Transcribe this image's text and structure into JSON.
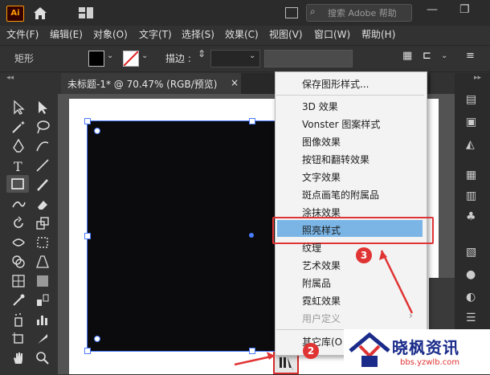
{
  "app": {
    "logo": "Ai"
  },
  "title_bar": {
    "search_placeholder": "搜索 Adobe 帮助"
  },
  "menu": [
    {
      "label": "文件(F)"
    },
    {
      "label": "编辑(E)"
    },
    {
      "label": "对象(O)"
    },
    {
      "label": "文字(T)"
    },
    {
      "label": "选择(S)"
    },
    {
      "label": "效果(C)"
    },
    {
      "label": "视图(V)"
    },
    {
      "label": "窗口(W)"
    },
    {
      "label": "帮助(H)"
    }
  ],
  "control_bar": {
    "shape_label": "矩形",
    "stroke_label": "描边 :"
  },
  "document_tab": {
    "label": "未标题-1* @ 70.47% (RGB/预览)",
    "close": "×"
  },
  "dropdown": {
    "items": [
      {
        "label": "保存图形样式..."
      },
      {
        "label": "3D 效果"
      },
      {
        "label": "Vonster 图案样式"
      },
      {
        "label": "图像效果"
      },
      {
        "label": "按钮和翻转效果"
      },
      {
        "label": "文字效果"
      },
      {
        "label": "斑点画笔的附属品"
      },
      {
        "label": "涂抹效果"
      },
      {
        "label": "照亮样式"
      },
      {
        "label": "纹理"
      },
      {
        "label": "艺术效果"
      },
      {
        "label": "附属品"
      },
      {
        "label": "霓虹效果"
      },
      {
        "label": "用户定义"
      },
      {
        "label": "其它库(O"
      }
    ],
    "selected": "照亮样式"
  },
  "annotations": {
    "step2": "2",
    "step3": "3"
  },
  "watermark": {
    "title": "晓枫资讯",
    "url": "bbs.yzwlb.com"
  },
  "colors": {
    "accent": "#e03434",
    "highlight": "#7ab5e6",
    "selection": "#4a7cff"
  }
}
